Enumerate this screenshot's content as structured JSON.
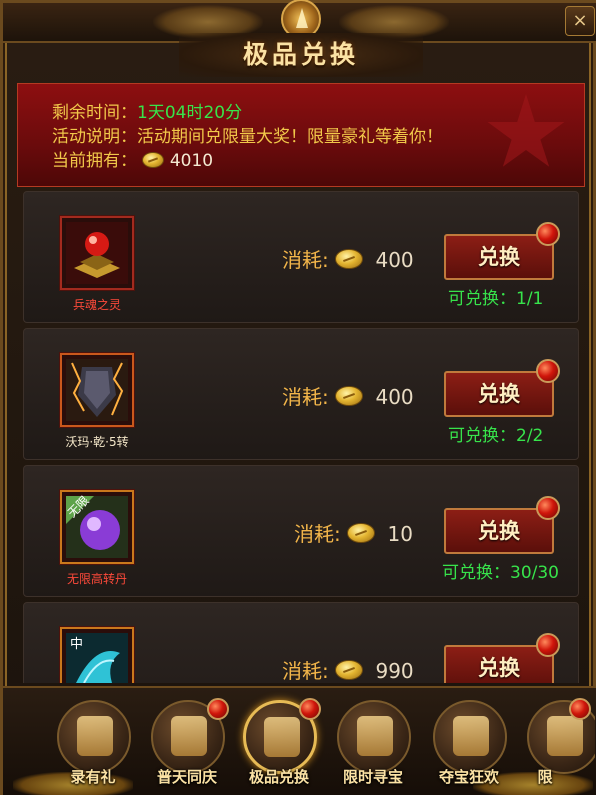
{
  "window": {
    "title": "极品兑换",
    "close_icon": "×"
  },
  "info": {
    "time_label": "剩余时间：",
    "time_value": "1天04时20分",
    "desc_label": "活动说明：",
    "desc_value": "活动期间兑限量大奖！限量豪礼等着你！",
    "owned_label": "当前拥有：",
    "owned_value": "4010"
  },
  "items": [
    {
      "name": "兵魂之灵",
      "name_color": "#ff4a3a",
      "cost_label": "消耗:",
      "cost": "400",
      "button": "兑换",
      "remaining": "可兑换：1/1"
    },
    {
      "name": "沃玛·乾·5转",
      "name_color": "#f3e6c8",
      "cost_label": "消耗:",
      "cost": "400",
      "button": "兑换",
      "remaining": "可兑换：2/2"
    },
    {
      "name": "无限高转丹",
      "name_color": "#ff4a3a",
      "cost_label": "消耗:",
      "cost": "10",
      "button": "兑换",
      "remaining": "可兑换：30/30"
    },
    {
      "name": "",
      "name_color": "#ff4a3a",
      "cost_label": "消耗:",
      "cost": "990",
      "button": "兑换",
      "remaining": ""
    }
  ],
  "nav": [
    {
      "label": "录有礼",
      "active": false
    },
    {
      "label": "普天同庆",
      "active": false
    },
    {
      "label": "极品兑换",
      "active": true
    },
    {
      "label": "限时寻宝",
      "active": false
    },
    {
      "label": "夺宝狂欢",
      "active": false
    },
    {
      "label": "限",
      "active": false
    }
  ],
  "colors": {
    "accent_gold": "#f1c84a",
    "green": "#38e34a",
    "panel_red": "#8d0f10"
  }
}
